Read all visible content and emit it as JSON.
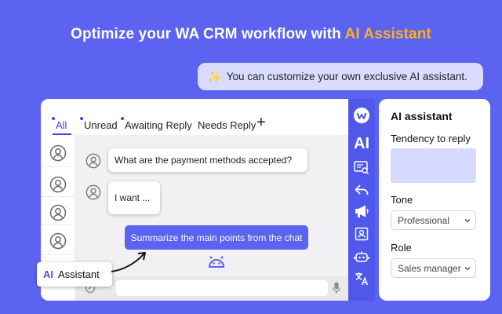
{
  "headline": {
    "prefix": "Optimize your WA CRM workflow with ",
    "highlight": "AI Assistant"
  },
  "top_bubble": {
    "icon": "sparkles-icon",
    "text": "You can customize your own exclusive AI assistant."
  },
  "tabs": [
    {
      "label": "All",
      "active": true,
      "dot": true
    },
    {
      "label": "Unread",
      "active": false,
      "dot": true
    },
    {
      "label": "Awaiting Reply",
      "active": false,
      "dot": true
    },
    {
      "label": "Needs Reply",
      "active": false,
      "dot": false
    }
  ],
  "chat": {
    "messages": [
      {
        "text": "What are the payment methods accepted?"
      },
      {
        "text": "I want ..."
      }
    ],
    "summarize_button": "Summarize the main points from the chat"
  },
  "toolbar": {
    "ai_label": "AI",
    "icons": [
      "wa-logo-icon",
      "chat-search-icon",
      "reply-icon",
      "megaphone-icon",
      "contact-card-icon",
      "robot-icon",
      "translate-icon"
    ]
  },
  "panel": {
    "title": "AI assistant",
    "tendency_label": "Tendency to reply",
    "tone_label": "Tone",
    "tone_value": "Professional",
    "role_label": "Role",
    "role_value": "Sales manager"
  },
  "chip": {
    "ai": "AI",
    "label": "Assistant"
  },
  "colors": {
    "background": "#5b63f0",
    "accent": "#ffb020",
    "toolbar": "#5058ec",
    "tendency_box": "#d6d9ff"
  }
}
